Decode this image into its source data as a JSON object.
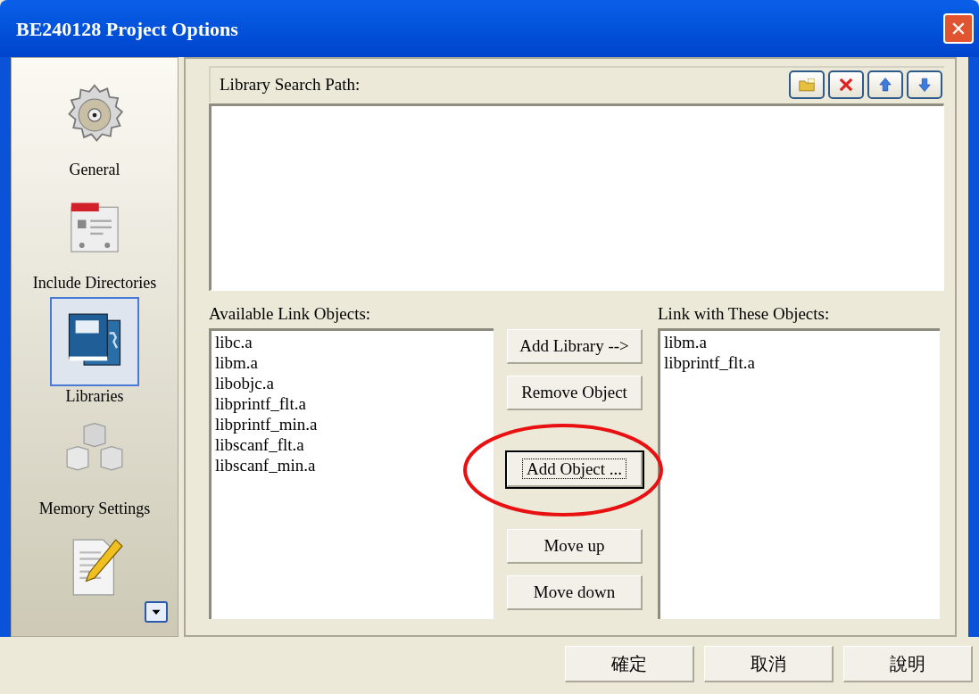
{
  "window": {
    "title": "BE240128 Project Options",
    "close": "✕"
  },
  "sidebar": {
    "items": [
      {
        "kind": "gear",
        "label": "General",
        "selected": false
      },
      {
        "kind": "card",
        "label": "Include Directories",
        "selected": false
      },
      {
        "kind": "books",
        "label": "Libraries",
        "selected": true
      },
      {
        "kind": "cubes",
        "label": "Memory Settings",
        "selected": false
      },
      {
        "kind": "note",
        "selected": false
      }
    ]
  },
  "search_path": {
    "label": "Library Search Path:",
    "tools": [
      {
        "kind": "folder"
      },
      {
        "kind": "delete"
      },
      {
        "kind": "up"
      },
      {
        "kind": "down"
      }
    ]
  },
  "available": {
    "label": "Available Link Objects:",
    "items": [
      "libc.a",
      "libm.a",
      "libobjc.a",
      "libprintf_flt.a",
      "libprintf_min.a",
      "libscanf_flt.a",
      "libscanf_min.a"
    ]
  },
  "action_groups": [
    [
      {
        "label": "Add Library -->",
        "focused": false,
        "highlighted": false
      },
      {
        "label": "Remove Object",
        "focused": false,
        "highlighted": false
      }
    ],
    [
      {
        "label": "Add Object ...",
        "focused": true,
        "highlighted": true
      }
    ],
    [
      {
        "label": "Move up",
        "focused": false,
        "highlighted": false
      },
      {
        "label": "Move down",
        "focused": false,
        "highlighted": false
      }
    ]
  ],
  "linked": {
    "label": "Link with These Objects:",
    "items": [
      "libm.a",
      "libprintf_flt.a"
    ]
  },
  "buttons": [
    "確定",
    "取消",
    "說明"
  ]
}
